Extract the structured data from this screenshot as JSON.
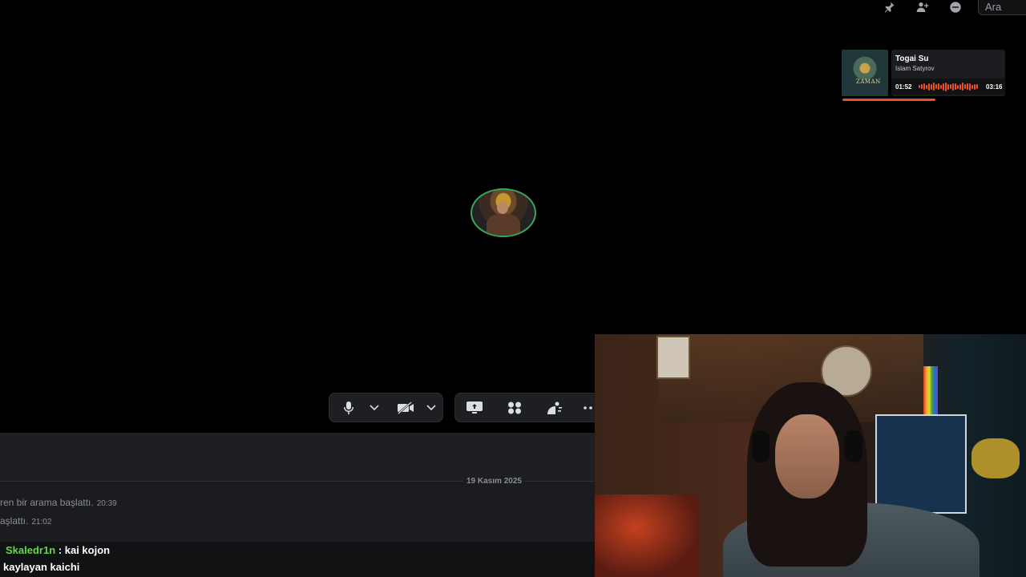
{
  "toolbar": {
    "icons": [
      "pin-icon",
      "add-member-icon",
      "inbox-icon"
    ],
    "search_placeholder": "Ara"
  },
  "now_playing": {
    "album_label": "ZAMAN",
    "title": "Togai Su",
    "artist": "Islam Satyrov",
    "elapsed": "01:52",
    "duration": "03:16",
    "progress": 0.57,
    "accent_color": "#e8502e"
  },
  "call": {
    "speaking_ring_color": "#3ba55d",
    "controls_left": [
      "microphone-icon",
      "chevron-down-icon",
      "camera-off-icon",
      "chevron-down-icon"
    ],
    "controls_right": [
      "screen-share-icon",
      "activities-icon",
      "soundboard-icon",
      "more-icon"
    ]
  },
  "chat": {
    "date_divider": "19 Kasım 2025",
    "system_messages": [
      {
        "text": "ren bir arama başlattı.",
        "time": "20:39"
      },
      {
        "text": "aşlattı.",
        "time": "21:02"
      }
    ]
  },
  "stream_overlay": {
    "messages": [
      {
        "user": "Skaledr1n",
        "separator": ":",
        "text": "kai kojon"
      },
      {
        "text": "kaylayan kaichi"
      }
    ],
    "username_color": "#6ad54a"
  }
}
